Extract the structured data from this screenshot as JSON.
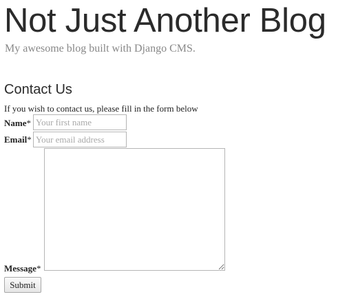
{
  "header": {
    "title": "Not Just Another Blog",
    "tagline": "My awesome blog built with Django CMS."
  },
  "page": {
    "heading": "Contact Us",
    "intro": "If you wish to contact us, please fill in the form below"
  },
  "form": {
    "name": {
      "label": "Name",
      "required_mark": "*",
      "value": "",
      "placeholder": "Your first name"
    },
    "email": {
      "label": "Email",
      "required_mark": "*",
      "value": "",
      "placeholder": "Your email address"
    },
    "message": {
      "label": "Message",
      "required_mark": "*",
      "value": ""
    },
    "submit_label": "Submit"
  }
}
